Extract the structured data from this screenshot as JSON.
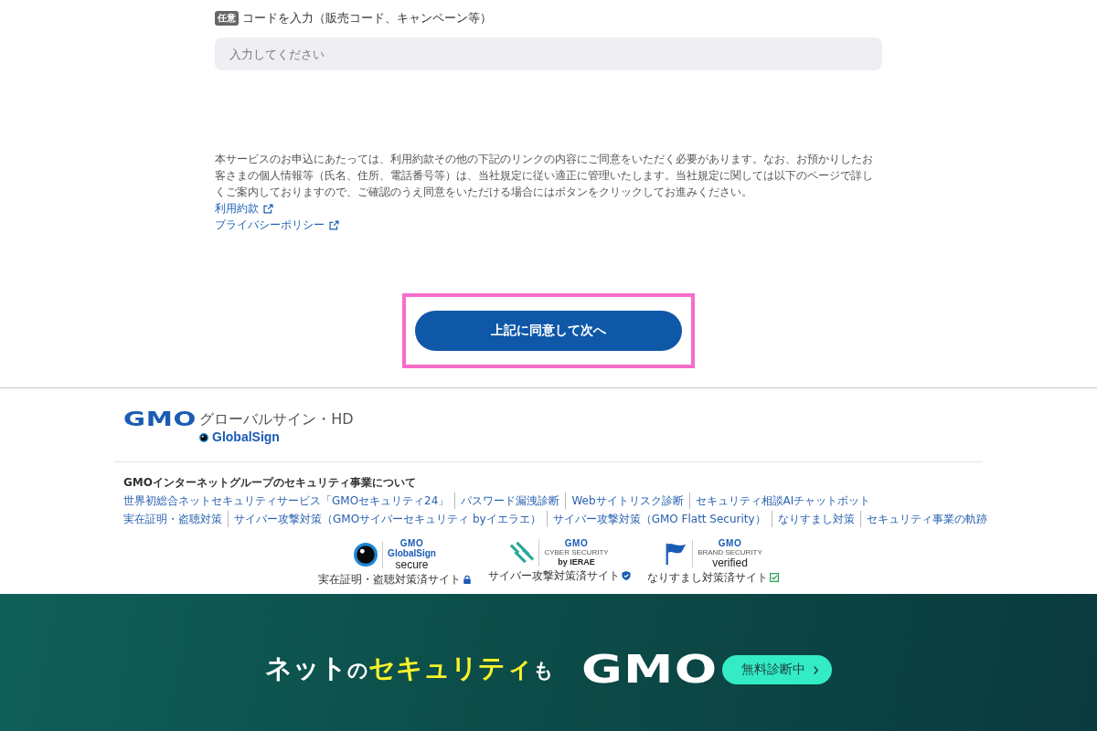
{
  "code_field": {
    "optional_badge": "任意",
    "label": "コードを入力（販売コード、キャンペーン等）",
    "placeholder": "入力してください"
  },
  "consent": {
    "text": "本サービスのお申込にあたっては、利用約款その他の下記のリンクの内容にご同意をいただく必要があります。なお、お預かりしたお客さまの個人情報等（氏名、住所、電話番号等）は、当社規定に従い適正に管理いたします。当社規定に関しては以下のページで詳しくご案内しておりますので、ご確認のうえ同意をいただける場合にはボタンをクリックしてお進みください。",
    "links": [
      {
        "label": "利用約款",
        "external": true
      },
      {
        "label": "プライバシーポリシー",
        "external": true
      }
    ]
  },
  "agree_button": {
    "label": "上記に同意して次へ",
    "highlighted": true
  },
  "footer": {
    "logo": {
      "mark": "GMO",
      "name": "グローバルサイン・HD",
      "brand": "GlobalSign"
    },
    "heading": "GMOインターネットグループのセキュリティ事業について",
    "link_rows": [
      [
        "世界初総合ネットセキュリティサービス「GMOセキュリティ24」",
        "パスワード漏洩診断",
        "Webサイトリスク診断",
        "セキュリティ相談AIチャットボット"
      ],
      [
        "実在証明・盗聴対策",
        "サイバー攻撃対策（GMOサイバーセキュリティ byイエラエ）",
        "サイバー攻撃対策（GMO Flatt Security）",
        "なりすまし対策",
        "セキュリティ事業の軌跡"
      ]
    ],
    "badges": [
      {
        "kind": "globalsign",
        "brand": "GMO",
        "title": "GlobalSign",
        "subtitle": "secure",
        "caption": "実在証明・盗聴対策済サイト"
      },
      {
        "kind": "cyber",
        "brand": "GMO",
        "title": "CYBER SECURITY",
        "subtitle": "by IERAE",
        "caption": "サイバー攻撃対策済サイト"
      },
      {
        "kind": "brand",
        "brand": "GMO",
        "title": "BRAND SECURITY",
        "subtitle": "verified",
        "caption": "なりすまし対策済サイト"
      }
    ]
  },
  "banner": {
    "tagline": [
      {
        "text": "ネット",
        "kind": "main"
      },
      {
        "text": "の",
        "kind": "particle"
      },
      {
        "text": "セキュリティ",
        "kind": "accent"
      },
      {
        "text": "も",
        "kind": "particle"
      }
    ],
    "logo": "GMO",
    "button": "無料診断中"
  }
}
